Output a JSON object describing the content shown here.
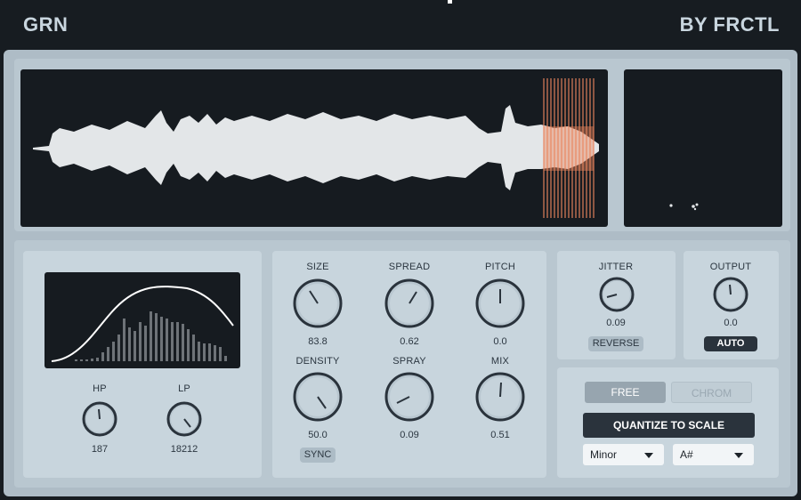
{
  "header": {
    "title": "GRN",
    "maker": "BY FRCTL"
  },
  "colors": {
    "accent": "#e8855e",
    "panel": "#c8d5dd",
    "dark": "#161b20"
  },
  "grain": {
    "knobs": [
      {
        "id": "size",
        "label": "SIZE",
        "value": "83.8"
      },
      {
        "id": "spread",
        "label": "SPREAD",
        "value": "0.62"
      },
      {
        "id": "pitch",
        "label": "PITCH",
        "value": "0.0"
      },
      {
        "id": "density",
        "label": "DENSITY",
        "value": "50.0"
      },
      {
        "id": "spray",
        "label": "SPRAY",
        "value": "0.09"
      },
      {
        "id": "mix",
        "label": "MIX",
        "value": "0.51"
      }
    ],
    "sync_label": "SYNC"
  },
  "filter": {
    "hp": {
      "label": "HP",
      "value": "187"
    },
    "lp": {
      "label": "LP",
      "value": "18212"
    }
  },
  "jitter": {
    "label": "JITTER",
    "value": "0.09",
    "reverse_label": "REVERSE"
  },
  "output": {
    "label": "OUTPUT",
    "value": "0.0",
    "auto_label": "AUTO"
  },
  "scale": {
    "free_label": "FREE",
    "chrom_label": "CHROM",
    "quantize_label": "QUANTIZE TO SCALE",
    "scale_value": "Minor",
    "key_value": "A#"
  }
}
